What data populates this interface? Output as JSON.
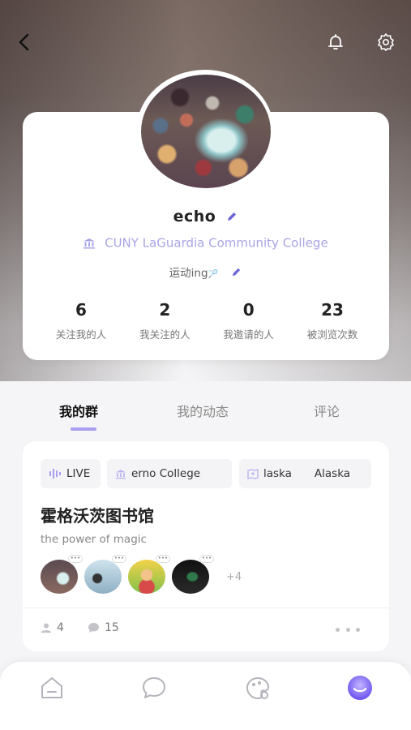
{
  "profile": {
    "name": "echo",
    "school": "CUNY LaGuardia Community College",
    "signature": "运动ing",
    "signature_emoji": "🏸"
  },
  "stats": [
    {
      "value": "6",
      "label": "关注我的人"
    },
    {
      "value": "2",
      "label": "我关注的人"
    },
    {
      "value": "0",
      "label": "我邀请的人"
    },
    {
      "value": "23",
      "label": "被浏览次数"
    }
  ],
  "tabs": [
    {
      "label": "我的群",
      "active": true
    },
    {
      "label": "我的动态",
      "active": false
    },
    {
      "label": "评论",
      "active": false
    }
  ],
  "group": {
    "tags": {
      "live": "LIVE",
      "college": "erno College",
      "alaska_a": "laska",
      "alaska_b": "Alaska"
    },
    "title": "霍格沃茨图书馆",
    "description": "the power of magic",
    "more_members": "+4",
    "member_count": "4",
    "comment_count": "15"
  },
  "colors": {
    "accent": "#a89ff0",
    "school_text": "#a9a4e6",
    "pencil": "#6a66d8"
  },
  "icons": [
    "back-arrow-icon",
    "bell-icon",
    "settings-icon",
    "pencil-icon",
    "school-icon",
    "live-icon",
    "map-icon",
    "person-icon",
    "comment-icon",
    "home-icon",
    "chat-icon",
    "discover-icon",
    "profile-icon"
  ]
}
